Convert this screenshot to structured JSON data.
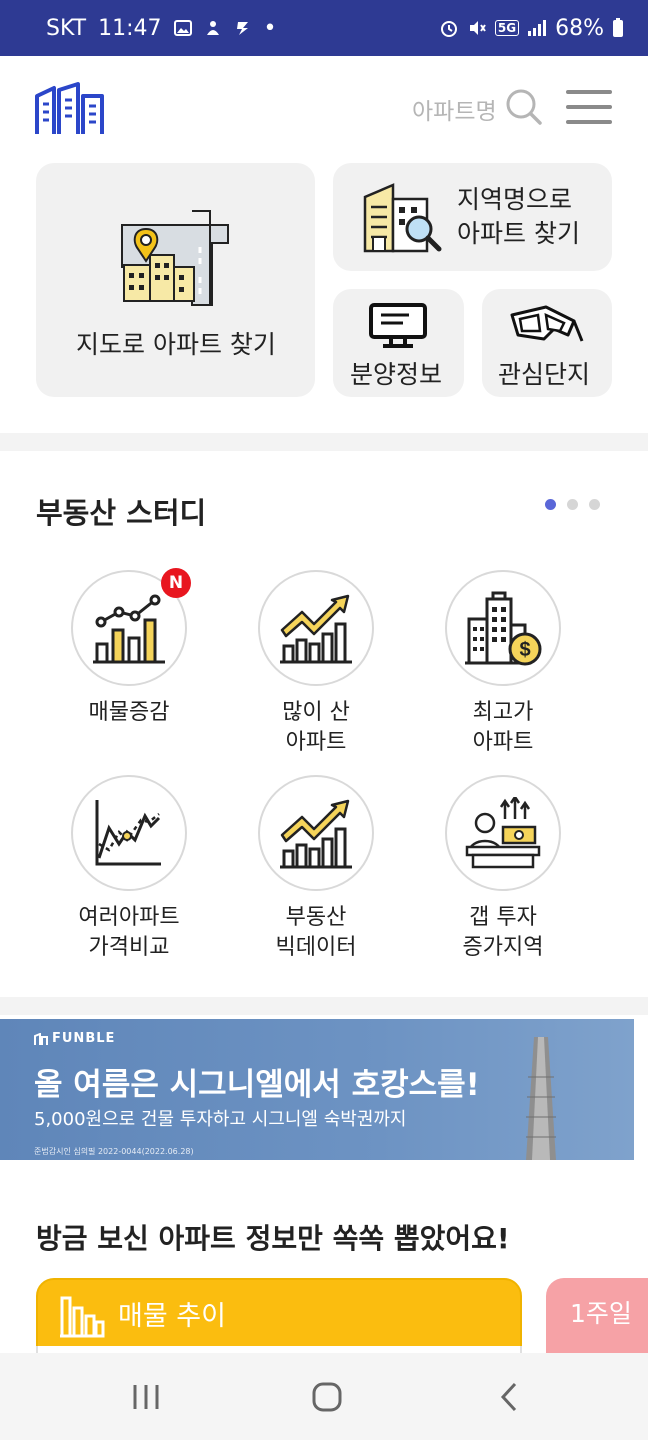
{
  "status_bar": {
    "carrier": "SKT",
    "time": "11:47",
    "dot": "•",
    "network": "5G",
    "battery": "68%"
  },
  "header": {
    "search_placeholder": "아파트명"
  },
  "quick_menu": {
    "map_search": "지도로 아파트 찾기",
    "region_search_line1": "지역명으로",
    "region_search_line2": "아파트 찾기",
    "presale": "분양정보",
    "favorites": "관심단지"
  },
  "study": {
    "title": "부동산 스터디",
    "badge": "N",
    "items": [
      {
        "label": "매물증감",
        "icon": "listing-change-icon"
      },
      {
        "label": "많이 산\n아파트",
        "icon": "most-bought-icon"
      },
      {
        "label": "최고가\n아파트",
        "icon": "highest-price-icon"
      },
      {
        "label": "여러아파트\n가격비교",
        "icon": "price-compare-icon"
      },
      {
        "label": "부동산\n빅데이터",
        "icon": "big-data-icon"
      },
      {
        "label": "갭 투자\n증가지역",
        "icon": "gap-investment-icon"
      }
    ]
  },
  "banner": {
    "brand": "FUNBLE",
    "headline": "올 여름은 시그니엘에서 호캉스를!",
    "subline": "5,000원으로 건물 투자하고 시그니엘 숙박권까지",
    "note": "준법감시인 심의필 2022-0044(2022.06.28)"
  },
  "recent": {
    "title": "방금 보신 아파트 정보만 쏙쏙 뽑았어요!",
    "card1_title": "매물 추이",
    "card2_title": "1주일"
  },
  "colors": {
    "status_bar": "#2e3a93",
    "accent": "#5a67d8",
    "yellow": "#fbbd0f",
    "pink": "#f6a2a6",
    "badge": "#e8161f"
  }
}
